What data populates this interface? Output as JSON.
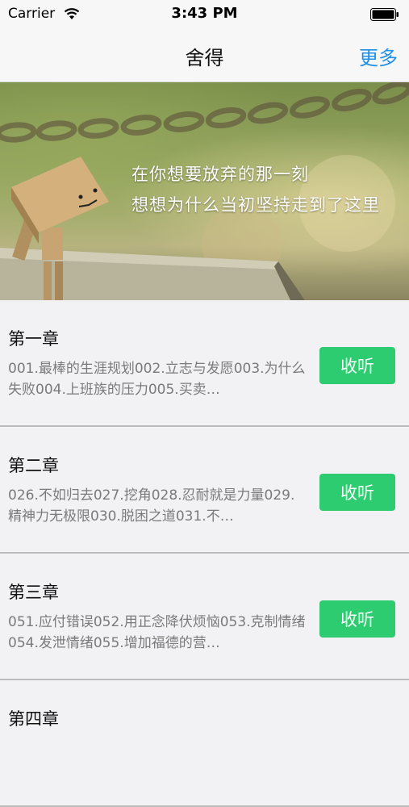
{
  "status_bar": {
    "carrier": "Carrier",
    "time": "3:43 PM"
  },
  "nav": {
    "title": "舍得",
    "more": "更多"
  },
  "banner": {
    "line1": "在你想要放弃的那一刻",
    "line2": "想想为什么当初坚持走到了这里"
  },
  "chapters": [
    {
      "title": "第一章",
      "desc": "001.最棒的生涯规划002.立志与发愿003.为什么失败004.上班族的压力005.买卖…",
      "button": "收听"
    },
    {
      "title": "第二章",
      "desc": "026.不如归去027.挖角028.忍耐就是力量029.精神力无极限030.脱困之道031.不…",
      "button": "收听"
    },
    {
      "title": "第三章",
      "desc": "051.应付错误052.用正念降伏烦恼053.克制情绪054.发泄情绪055.增加福德的营…",
      "button": "收听"
    },
    {
      "title": "第四章"
    }
  ]
}
